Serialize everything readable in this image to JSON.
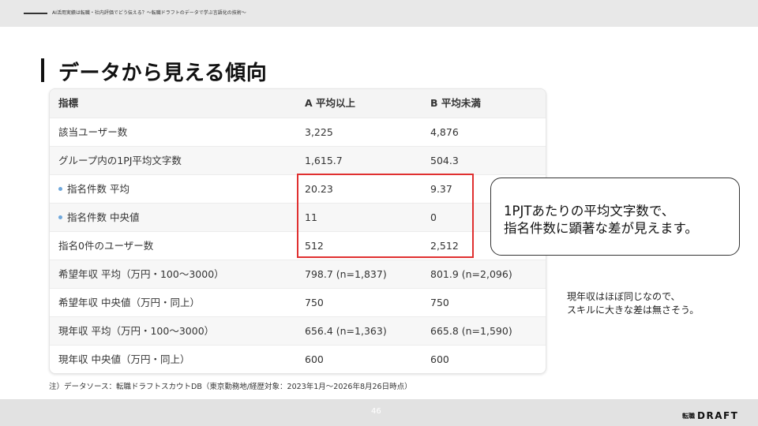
{
  "header": {
    "breadcrumb": "AI活用実績は転職・社内評価でどう伝える？〜転職ドラフトのデータで学ぶ言語化の技術〜"
  },
  "slide": {
    "title": "データから見える傾向"
  },
  "table": {
    "headers": [
      "指標",
      "A 平均以上",
      "B 平均未満"
    ],
    "rows": [
      {
        "metric": "該当ユーザー数",
        "a": "3,225",
        "b": "4,876"
      },
      {
        "metric": "グループ内の1PJ平均文字数",
        "a": "1,615.7",
        "b": "504.3"
      },
      {
        "metric": "指名件数 平均",
        "a": "20.23",
        "b": "9.37"
      },
      {
        "metric": "指名件数 中央値",
        "a": "11",
        "b": "0"
      },
      {
        "metric": "指名0件のユーザー数",
        "a": "512",
        "b": "2,512"
      },
      {
        "metric": "希望年収 平均（万円・100〜3000）",
        "a": "798.7 (n=1,837)",
        "b": "801.9 (n=2,096)"
      },
      {
        "metric": "希望年収 中央値（万円・同上）",
        "a": "750",
        "b": "750"
      },
      {
        "metric": "現年収 平均（万円・100〜3000）",
        "a": "656.4 (n=1,363)",
        "b": "665.8 (n=1,590)"
      },
      {
        "metric": "現年収 中央値（万円・同上）",
        "a": "600",
        "b": "600"
      }
    ]
  },
  "callout": {
    "line1": "1PJTあたりの平均文字数で、",
    "line2": "指名件数に顕著な差が見えます。"
  },
  "note": {
    "line1": "現年収はほぼ同じなので、",
    "line2": "スキルに大きな差は無さそう。"
  },
  "footnote": "注）データソース：転職ドラフトスカウトDB（東京勤務地/経歴対象：2023年1月〜2026年8月26日時点）",
  "footer": {
    "page": "46",
    "logo_small": "転職",
    "logo_big": "DRAFT"
  }
}
